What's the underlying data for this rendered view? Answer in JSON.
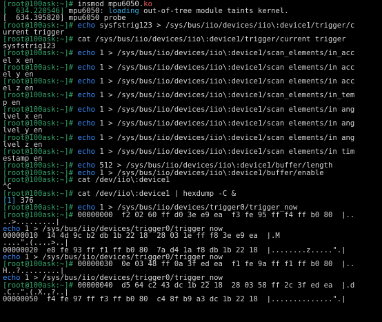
{
  "terminal": {
    "lines": [
      {
        "type": "prompt",
        "prompt": "[root@100ask:~]#",
        "pre": " insmod mpu6050.",
        "ko": "ko",
        "post": ""
      },
      {
        "type": "ts",
        "ts": "[  634.220546]",
        "text": " mpu6050: ",
        "hl": "loading",
        "post": " out-of-tree module taints kernel."
      },
      {
        "type": "out",
        "text": "[  634.395820] mpu6050 probe"
      },
      {
        "type": "cmd",
        "prompt": "[root@100ask:~]#",
        "kw": " echo",
        "rest": " sysfstrig123 > /sys/bus/iio/devices/iio\\:device1/trigger/c"
      },
      {
        "type": "out",
        "text": "urrent_trigger"
      },
      {
        "type": "cmdplain",
        "prompt": "[root@100ask:~]#",
        "rest": " cat /sys/bus/iio/devices/iio\\:device1/trigger/current_trigger"
      },
      {
        "type": "out",
        "text": "sysfstrig123"
      },
      {
        "type": "cmd",
        "prompt": "[root@100ask:~]#",
        "kw": " echo",
        "rest": " 1 > /sys/bus/iio/devices/iio\\:device1/scan_elements/in_acc"
      },
      {
        "type": "out",
        "text": "el_x_en"
      },
      {
        "type": "cmd",
        "prompt": "[root@100ask:~]#",
        "kw": " echo",
        "rest": " 1 > /sys/bus/iio/devices/iio\\:device1/scan_elements/in_acc"
      },
      {
        "type": "out",
        "text": "el_y_en"
      },
      {
        "type": "cmd",
        "prompt": "[root@100ask:~]#",
        "kw": " echo",
        "rest": " 1 > /sys/bus/iio/devices/iio\\:device1/scan_elements/in_acc"
      },
      {
        "type": "out",
        "text": "el_z_en"
      },
      {
        "type": "cmd",
        "prompt": "[root@100ask:~]#",
        "kw": " echo",
        "rest": " 1 > /sys/bus/iio/devices/iio\\:device1/scan_elements/in_tem"
      },
      {
        "type": "out",
        "text": "p_en"
      },
      {
        "type": "cmd",
        "prompt": "[root@100ask:~]#",
        "kw": " echo",
        "rest": " 1 > /sys/bus/iio/devices/iio\\:device1/scan_elements/in_ang"
      },
      {
        "type": "out",
        "text": "lvel_x_en"
      },
      {
        "type": "cmd",
        "prompt": "[root@100ask:~]#",
        "kw": " echo",
        "rest": " 1 > /sys/bus/iio/devices/iio\\:device1/scan_elements/in_ang"
      },
      {
        "type": "out",
        "text": "lvel_y_en"
      },
      {
        "type": "cmd",
        "prompt": "[root@100ask:~]#",
        "kw": " echo",
        "rest": " 1 > /sys/bus/iio/devices/iio\\:device1/scan_elements/in_ang"
      },
      {
        "type": "out",
        "text": "lvel_z_en"
      },
      {
        "type": "cmd",
        "prompt": "[root@100ask:~]#",
        "kw": " echo",
        "rest": " 1 > /sys/bus/iio/devices/iio\\:device1/scan_elements/in_tim"
      },
      {
        "type": "out",
        "text": "estamp_en"
      },
      {
        "type": "cmd",
        "prompt": "[root@100ask:~]#",
        "kw": " echo",
        "rest": " 512 > /sys/bus/iio/devices/iio\\:device1/buffer/length"
      },
      {
        "type": "cmd",
        "prompt": "[root@100ask:~]#",
        "kw": " echo",
        "rest": " 1 > /sys/bus/iio/devices/iio\\:device1/buffer/enable"
      },
      {
        "type": "cmdplain",
        "prompt": "[root@100ask:~]#",
        "rest": " cat /dev/iio\\:device1"
      },
      {
        "type": "out",
        "text": "^C"
      },
      {
        "type": "cmdplain",
        "prompt": "[root@100ask:~]#",
        "rest": " cat /dev/iio\\:device1 | hexdump -C &"
      },
      {
        "type": "job",
        "job": "[1]",
        "rest": " 376"
      },
      {
        "type": "cmd",
        "prompt": "[root@100ask:~]#",
        "kw": " echo",
        "rest": " 1 > /sys/bus/iio/devices/trigger0/trigger_now"
      },
      {
        "type": "cmdplain",
        "prompt": "[root@100ask:~]#",
        "rest": " 00000000  f2 02 60 ff d0 3e e9 ea  f3 fe 95 ff f4 ff b0 80  |.."
      },
      {
        "type": "out",
        "text": "..>.........|"
      },
      {
        "type": "echoline",
        "kw": "echo",
        "rest": " 1 > /sys/bus/iio/devices/trigger0/trigger_now"
      },
      {
        "type": "out",
        "text": "00000010  14 4d 9c b2 db 1b 22 18  28 03 1e ff f8 3e e9 ea  |.M"
      },
      {
        "type": "out",
        "text": "....\".(....>..|"
      },
      {
        "type": "out",
        "text": "00000020  e8 fe 93 ff f1 ff b0 80  7a d4 1a f8 db 1b 22 18  |........z.....\".|"
      },
      {
        "type": "echoline",
        "kw": "echo",
        "rest": " 1 > /sys/bus/iio/devices/trigger0/trigger_now"
      },
      {
        "type": "cmdplain",
        "prompt": "[root@100ask:~]#",
        "rest": " 00000030  0e 03 48 ff 0a 3f ed ea  f1 fe 9a ff f1 ff b0 80  |.."
      },
      {
        "type": "out",
        "text": "H..?.........|"
      },
      {
        "type": "echoline",
        "kw": "echo",
        "rest": " 1 > /sys/bus/iio/devices/trigger0/trigger_now"
      },
      {
        "type": "cmdplain",
        "prompt": "[root@100ask:~]#",
        "rest": " 00000040  d5 64 c2 43 dc 1b 22 18  28 03 58 ff 2c 3f ed ea  |.d"
      },
      {
        "type": "out",
        "text": ".C..\".(.X.,?..|"
      },
      {
        "type": "out",
        "text": "00000050  f4 fe 97 ff f3 ff b0 80  c4 8f b9 a3 dc 1b 22 18  |..............\".|"
      }
    ]
  }
}
